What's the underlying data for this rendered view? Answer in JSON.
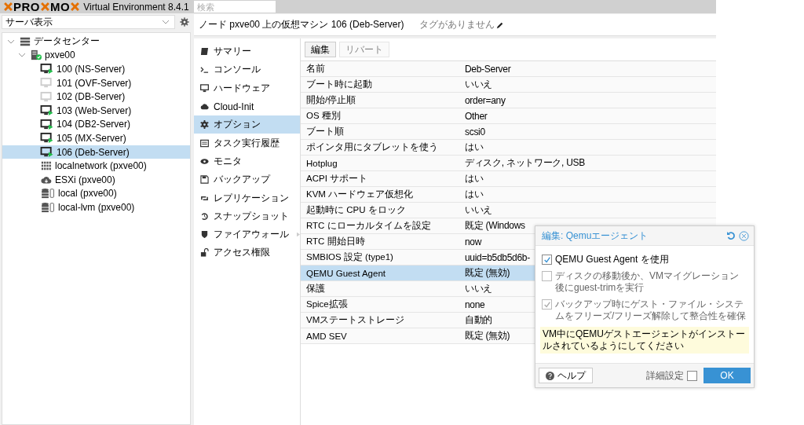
{
  "topbar": {
    "logo_left": "PRO",
    "logo_mid": "MO",
    "product": "Virtual Environment 8.4.1",
    "search": {
      "placeholder": "検索"
    }
  },
  "view_selector": {
    "value": "サーバ表示"
  },
  "tree": [
    {
      "label": "データセンター",
      "kind": "datacenter",
      "expanded": true,
      "selected": false,
      "children": [
        {
          "label": "pxve00",
          "kind": "node",
          "expanded": true,
          "selected": false,
          "children": [
            {
              "label": "100 (NS-Server)",
              "kind": "vm",
              "running": true,
              "selected": false
            },
            {
              "label": "101 (OVF-Server)",
              "kind": "vm",
              "running": false,
              "selected": false
            },
            {
              "label": "102 (DB-Server)",
              "kind": "vm",
              "running": false,
              "selected": false
            },
            {
              "label": "103 (Web-Server)",
              "kind": "vm",
              "running": true,
              "selected": false
            },
            {
              "label": "104 (DB2-Server)",
              "kind": "vm",
              "running": true,
              "selected": false
            },
            {
              "label": "105 (MX-Server)",
              "kind": "vm",
              "running": true,
              "selected": false
            },
            {
              "label": "106 (Deb-Server)",
              "kind": "vm",
              "running": true,
              "selected": true
            },
            {
              "label": "localnetwork (pxve00)",
              "kind": "network",
              "selected": false
            },
            {
              "label": "ESXi (pxve00)",
              "kind": "esxi",
              "selected": false
            },
            {
              "label": "local (pxve00)",
              "kind": "storage",
              "selected": false
            },
            {
              "label": "local-lvm (pxve00)",
              "kind": "storage",
              "selected": false
            }
          ]
        }
      ]
    }
  ],
  "header": {
    "title": "ノード pxve00 上の仮想マシン 106 (Deb-Server)",
    "tags": "タグがありません"
  },
  "nav": [
    {
      "label": "サマリー",
      "kind": "book",
      "selected": false
    },
    {
      "label": "コンソール",
      "kind": "terminal",
      "selected": false
    },
    {
      "label": "ハードウェア",
      "kind": "monitor",
      "selected": false
    },
    {
      "label": "Cloud-Init",
      "kind": "cloud",
      "selected": false
    },
    {
      "label": "オプション",
      "kind": "gear",
      "selected": true
    },
    {
      "label": "タスク実行履歴",
      "kind": "list",
      "selected": false
    },
    {
      "label": "モニタ",
      "kind": "eye",
      "selected": false
    },
    {
      "label": "バックアップ",
      "kind": "save",
      "selected": false
    },
    {
      "label": "レプリケーション",
      "kind": "retweet",
      "selected": false
    },
    {
      "label": "スナップショット",
      "kind": "history",
      "selected": false
    },
    {
      "label": "ファイアウォール",
      "kind": "shield",
      "selected": false,
      "submenu": true
    },
    {
      "label": "アクセス権限",
      "kind": "unlock",
      "selected": false
    }
  ],
  "toolbar": [
    {
      "label": "編集",
      "disabled": false
    },
    {
      "label": "リバート",
      "disabled": true
    }
  ],
  "options": [
    {
      "name": "名前",
      "value": "Deb-Server",
      "selected": false
    },
    {
      "name": "ブート時に起動",
      "value": "いいえ",
      "selected": false
    },
    {
      "name": "開始/停止順",
      "value": "order=any",
      "selected": false
    },
    {
      "name": "OS 種別",
      "value": "Other",
      "selected": false
    },
    {
      "name": "ブート順",
      "value": "scsi0",
      "selected": false
    },
    {
      "name": "ポインタ用にタブレットを使う",
      "value": "はい",
      "selected": false
    },
    {
      "name": "Hotplug",
      "value": "ディスク, ネットワーク, USB",
      "selected": false
    },
    {
      "name": "ACPI サポート",
      "value": "はい",
      "selected": false
    },
    {
      "name": "KVM ハードウェア仮想化",
      "value": "はい",
      "selected": false
    },
    {
      "name": "起動時に CPU をロック",
      "value": "いいえ",
      "selected": false
    },
    {
      "name": "RTC にローカルタイムを設定",
      "value": "既定 (Windows",
      "selected": false
    },
    {
      "name": "RTC 開始日時",
      "value": "now",
      "selected": false
    },
    {
      "name": "SMBIOS 設定 (type1)",
      "value": "uuid=b5db5d6b-",
      "selected": false
    },
    {
      "name": "QEMU Guest Agent",
      "value": "既定 (無効)",
      "selected": true
    },
    {
      "name": "保護",
      "value": "いいえ",
      "selected": false
    },
    {
      "name": "Spice拡張",
      "value": "none",
      "selected": false
    },
    {
      "name": "VMステートストレージ",
      "value": "自動的",
      "selected": false
    },
    {
      "name": "AMD SEV",
      "value": "既定 (無効)",
      "selected": false
    }
  ],
  "dialog": {
    "title": "編集: Qemuエージェント",
    "checkboxes": [
      {
        "label": "QEMU Guest Agent を使用",
        "checked": true,
        "disabled": false
      },
      {
        "label": "ディスクの移動後か、VMマイグレーション後にguest-trimを実行",
        "checked": false,
        "disabled": true
      },
      {
        "label": "バックアップ時にゲスト・ファイル・システムをフリーズ/フリーズ解除して整合性を確保",
        "checked": true,
        "disabled": true
      }
    ],
    "note": "VM中にQEMUゲストエージェントがインストールされているようにしてください",
    "help": "ヘルプ",
    "advanced": {
      "label": "詳細設定",
      "checked": false
    },
    "ok": "OK"
  }
}
